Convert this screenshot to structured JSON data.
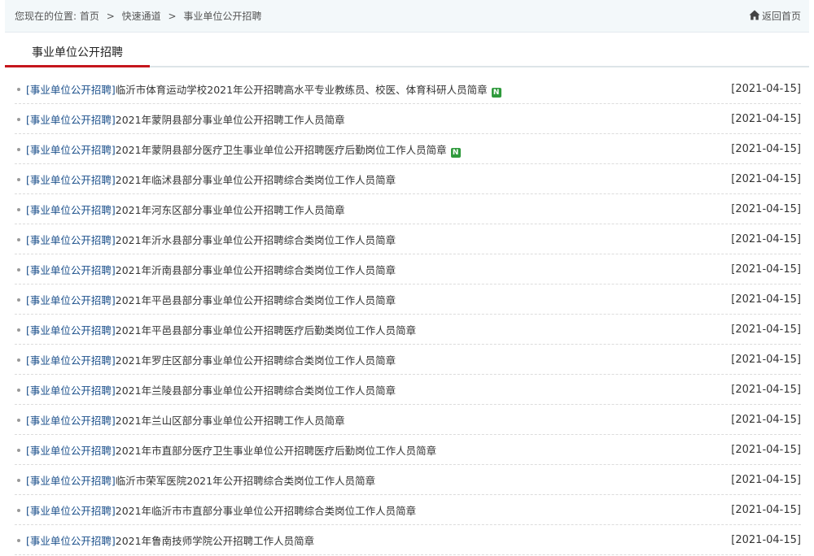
{
  "breadcrumb": {
    "prefix": "您现在的位置:",
    "items": [
      "首页",
      "快速通道",
      "事业单位公开招聘"
    ],
    "separator": ">",
    "home_label": "返回首页",
    "home_icon": "home-icon"
  },
  "section": {
    "title": "事业单位公开招聘"
  },
  "colors": {
    "accent": "#c5161d",
    "category": "#1a4f8b",
    "badge": "#2f9a3c"
  },
  "news": [
    {
      "category": "[事业单位公开招聘]",
      "title": "临沂市体育运动学校2021年公开招聘高水平专业教练员、校医、体育科研人员简章",
      "date": "[2021-04-15]",
      "badge": "N"
    },
    {
      "category": "[事业单位公开招聘]",
      "title": "2021年蒙阴县部分事业单位公开招聘工作人员简章",
      "date": "[2021-04-15]"
    },
    {
      "category": "[事业单位公开招聘]",
      "title": "2021年蒙阴县部分医疗卫生事业单位公开招聘医疗后勤岗位工作人员简章",
      "date": "[2021-04-15]",
      "badge": "N"
    },
    {
      "category": "[事业单位公开招聘]",
      "title": "2021年临沭县部分事业单位公开招聘综合类岗位工作人员简章",
      "date": "[2021-04-15]"
    },
    {
      "category": "[事业单位公开招聘]",
      "title": "2021年河东区部分事业单位公开招聘工作人员简章",
      "date": "[2021-04-15]"
    },
    {
      "category": "[事业单位公开招聘]",
      "title": "2021年沂水县部分事业单位公开招聘综合类岗位工作人员简章",
      "date": "[2021-04-15]"
    },
    {
      "category": "[事业单位公开招聘]",
      "title": "2021年沂南县部分事业单位公开招聘综合类岗位工作人员简章",
      "date": "[2021-04-15]"
    },
    {
      "category": "[事业单位公开招聘]",
      "title": "2021年平邑县部分事业单位公开招聘综合类岗位工作人员简章",
      "date": "[2021-04-15]"
    },
    {
      "category": "[事业单位公开招聘]",
      "title": "2021年平邑县部分事业单位公开招聘医疗后勤类岗位工作人员简章",
      "date": "[2021-04-15]"
    },
    {
      "category": "[事业单位公开招聘]",
      "title": "2021年罗庄区部分事业单位公开招聘综合类岗位工作人员简章",
      "date": "[2021-04-15]"
    },
    {
      "category": "[事业单位公开招聘]",
      "title": "2021年兰陵县部分事业单位公开招聘综合类岗位工作人员简章",
      "date": "[2021-04-15]"
    },
    {
      "category": "[事业单位公开招聘]",
      "title": "2021年兰山区部分事业单位公开招聘工作人员简章",
      "date": "[2021-04-15]"
    },
    {
      "category": "[事业单位公开招聘]",
      "title": "2021年市直部分医疗卫生事业单位公开招聘医疗后勤岗位工作人员简章",
      "date": "[2021-04-15]"
    },
    {
      "category": "[事业单位公开招聘]",
      "title": "临沂市荣军医院2021年公开招聘综合类岗位工作人员简章",
      "date": "[2021-04-15]"
    },
    {
      "category": "[事业单位公开招聘]",
      "title": "2021年临沂市市直部分事业单位公开招聘综合类岗位工作人员简章",
      "date": "[2021-04-15]"
    },
    {
      "category": "[事业单位公开招聘]",
      "title": "2021年鲁南技师学院公开招聘工作人员简章",
      "date": "[2021-04-15]"
    }
  ]
}
